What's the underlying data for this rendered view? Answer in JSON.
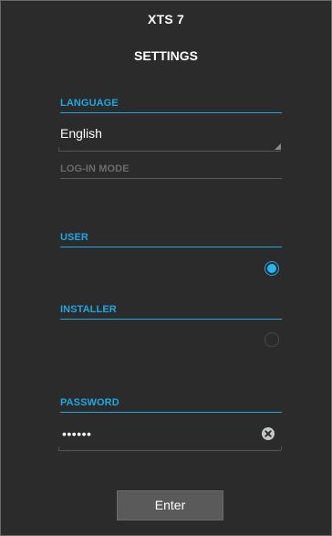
{
  "app": {
    "title": "XTS 7"
  },
  "page": {
    "title": "SETTINGS"
  },
  "language": {
    "label": "LANGUAGE",
    "value": "English"
  },
  "login_mode": {
    "label": "LOG-IN MODE",
    "options": [
      {
        "label": "USER",
        "selected": true
      },
      {
        "label": "INSTALLER",
        "selected": false
      }
    ]
  },
  "password": {
    "label": "PASSWORD",
    "value": "••••••"
  },
  "actions": {
    "enter_label": "Enter"
  },
  "colors": {
    "accent": "#1fa7e1",
    "background": "#2b2b2b",
    "button": "#5a5a5a"
  }
}
